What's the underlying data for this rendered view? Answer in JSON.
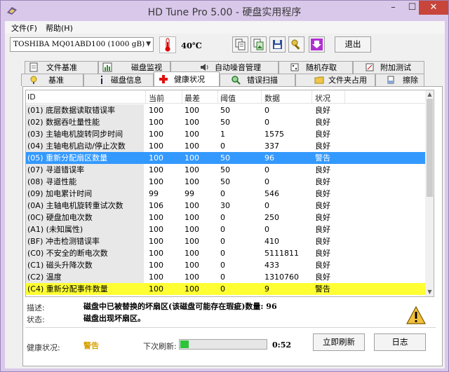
{
  "window": {
    "title": "HD Tune Pro 5.00 - 硬盘实用程序"
  },
  "menu": {
    "file": "文件(F)",
    "help": "帮助(H)"
  },
  "toolbar": {
    "drive": "TOSHIBA MQ01ABD100 (1000 gB)",
    "temperature": "40℃",
    "exit_label": "退出"
  },
  "tabs_top": [
    "文件基准",
    "磁盘监视",
    "自动噪音管理",
    "随机存取",
    "附加测试"
  ],
  "tabs_bottom": [
    "基准",
    "磁盘信息",
    "健康状况",
    "错误扫描",
    "文件夹占用",
    "擦除"
  ],
  "table": {
    "headers": [
      "ID",
      "当前",
      "最差",
      "阈值",
      "数据",
      "状况"
    ],
    "rows": [
      {
        "id": "(01) 底层数据读取错误率",
        "current": "100",
        "worst": "100",
        "threshold": "50",
        "data": "0",
        "status": "良好",
        "state": ""
      },
      {
        "id": "(02) 数据吞吐量性能",
        "current": "100",
        "worst": "100",
        "threshold": "50",
        "data": "0",
        "status": "良好",
        "state": ""
      },
      {
        "id": "(03) 主轴电机旋转同步时间",
        "current": "100",
        "worst": "100",
        "threshold": "1",
        "data": "1575",
        "status": "良好",
        "state": ""
      },
      {
        "id": "(04) 主轴电机启动/停止次数",
        "current": "100",
        "worst": "100",
        "threshold": "0",
        "data": "337",
        "status": "良好",
        "state": ""
      },
      {
        "id": "(05) 重新分配扇区数量",
        "current": "100",
        "worst": "100",
        "threshold": "50",
        "data": "96",
        "status": "警告",
        "state": "selected"
      },
      {
        "id": "(07) 寻道错误率",
        "current": "100",
        "worst": "100",
        "threshold": "50",
        "data": "0",
        "status": "良好",
        "state": ""
      },
      {
        "id": "(08) 寻道性能",
        "current": "100",
        "worst": "100",
        "threshold": "50",
        "data": "0",
        "status": "良好",
        "state": ""
      },
      {
        "id": "(09) 加电累计时间",
        "current": "99",
        "worst": "99",
        "threshold": "0",
        "data": "546",
        "status": "良好",
        "state": ""
      },
      {
        "id": "(0A) 主轴电机旋转重试次数",
        "current": "106",
        "worst": "100",
        "threshold": "30",
        "data": "0",
        "status": "良好",
        "state": ""
      },
      {
        "id": "(0C) 硬盘加电次数",
        "current": "100",
        "worst": "100",
        "threshold": "0",
        "data": "250",
        "status": "良好",
        "state": ""
      },
      {
        "id": "(A1) (未知属性)",
        "current": "100",
        "worst": "100",
        "threshold": "0",
        "data": "0",
        "status": "良好",
        "state": ""
      },
      {
        "id": "(BF) 冲击检测错误率",
        "current": "100",
        "worst": "100",
        "threshold": "0",
        "data": "410",
        "status": "良好",
        "state": ""
      },
      {
        "id": "(C0) 不安全的断电次数",
        "current": "100",
        "worst": "100",
        "threshold": "0",
        "data": "5111811",
        "status": "良好",
        "state": ""
      },
      {
        "id": "(C1) 磁头升降次数",
        "current": "100",
        "worst": "100",
        "threshold": "0",
        "data": "433",
        "status": "良好",
        "state": ""
      },
      {
        "id": "(C2) 温度",
        "current": "100",
        "worst": "100",
        "threshold": "0",
        "data": "1310760",
        "status": "良好",
        "state": ""
      },
      {
        "id": "(C4) 重新分配事件数量",
        "current": "100",
        "worst": "100",
        "threshold": "0",
        "data": "9",
        "status": "警告",
        "state": "warning"
      }
    ]
  },
  "details": {
    "desc_label": "描述:",
    "desc_text": "磁盘中已被替换的坏扇区(该磁盘可能存在瑕疵)数量: 96",
    "status_label": "状态:",
    "status_text": "磁盘出现坏扇区。"
  },
  "footer": {
    "health_label": "健康状况:",
    "health_value": "警告",
    "refresh_label": "下次刷新:",
    "refresh_progress": 0.1,
    "countdown": "0:52",
    "refresh_now_label": "立即刷新",
    "log_label": "日志"
  },
  "colors": {
    "selected_row": "#3399ff",
    "warning_row": "#ffff33",
    "warning_text": "#d8a000",
    "progress": "#2fc33a"
  }
}
